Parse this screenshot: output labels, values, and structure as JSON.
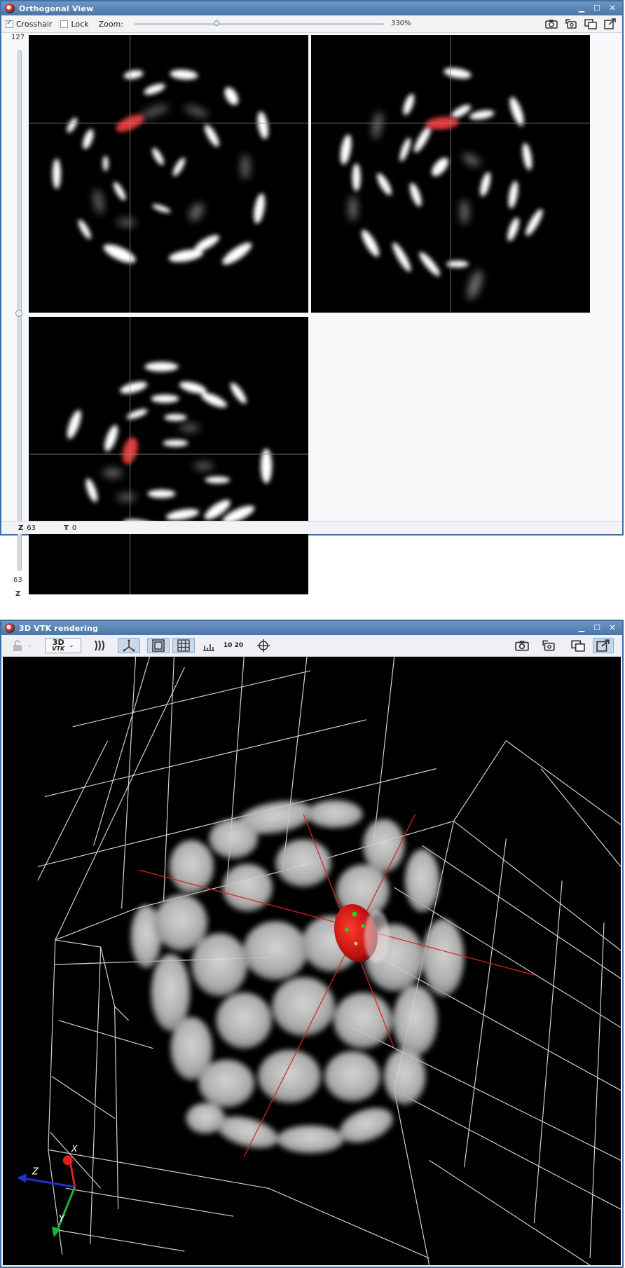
{
  "ortho": {
    "title": "Orthogonal View",
    "crosshair_label": "Crosshair",
    "crosshair_checked": true,
    "lock_label": "Lock",
    "lock_checked": false,
    "zoom_label": "Zoom:",
    "zoom_value": "330%",
    "slider_max": "127",
    "slider_value": "63",
    "slider_axis": "Z",
    "status": {
      "z_label": "Z",
      "z_value": "63",
      "t_label": "T",
      "t_value": "0"
    },
    "toolbar_icons": [
      "camera-icon",
      "snapshot-copy-icon",
      "detach-window-icon",
      "export-icon"
    ]
  },
  "vtk": {
    "title": "3D VTK rendering",
    "render_mode_label": "3D",
    "render_mode_sub": "VTK",
    "bounds_label": "10 20",
    "axes": {
      "x": "X",
      "y": "Y",
      "z": "Z"
    },
    "toolbar_icons": [
      "lock-icon",
      "render-mode-icon",
      "shading-icon",
      "axes-icon",
      "bounding-box-icon",
      "grid-icon",
      "ruler-icon",
      "bounds-label-icon",
      "picking-icon",
      "camera-icon",
      "snapshot-copy-icon",
      "detach-window-icon",
      "export-icon"
    ]
  },
  "window_controls": [
    "minimize",
    "maximize",
    "close"
  ],
  "colors": {
    "titlebar": "#4a76a8",
    "highlight": "#e03030",
    "crosshair": "#8a8a8a"
  }
}
